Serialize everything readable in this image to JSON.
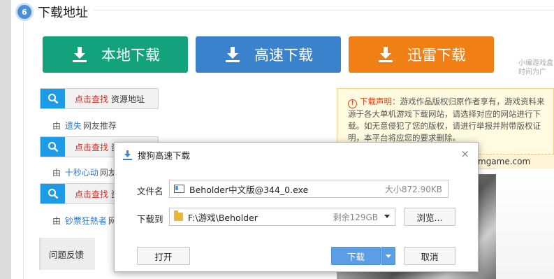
{
  "section": {
    "number": "6",
    "title": "下载地址"
  },
  "buttons": {
    "local": "本地下载",
    "fast": "高速下载",
    "thunder": "迅雷下载"
  },
  "ad": {
    "line1": "小编游戏盒",
    "line2": "时间为广"
  },
  "notice": {
    "label": "下载声明：",
    "text": "游戏作品版权归原作者享有，游戏资料来源于各大单机游戏下载网站，请选择对应的网站进行下载。如无意侵犯了您的版权，请进行举报并附带版权证明，本平台将应您的要求删除。",
    "url": "mgame.com"
  },
  "sources": [
    {
      "action": "点击查找",
      "label": "资源地址",
      "prefix": "由",
      "user": "遗失",
      "suffix": "网友推荐"
    },
    {
      "action": "点击查找",
      "label": "资",
      "prefix": "由",
      "user": "十秒心动",
      "suffix": "网友"
    },
    {
      "action": "点击查找",
      "label": "资",
      "prefix": "由",
      "user": "钞票狂熱者",
      "suffix": "网"
    }
  ],
  "feedback": "问题反馈",
  "dialog": {
    "title": "搜狗高速下载",
    "close": "×",
    "file_label": "文件名",
    "file_name": "Beholder中文版@344_0.exe",
    "file_size": "大小872.90KB",
    "dest_label": "下载到",
    "dest_path": "F:\\游戏\\Beholder",
    "free_space": "剩余129GB",
    "browse": "浏览...",
    "open": "打开",
    "download": "下载",
    "cancel": "取消"
  },
  "colors": {
    "local": "#12a37c",
    "fast": "#3a83cc",
    "thunder": "#f07f16",
    "accent_blue": "#1e9be6",
    "red": "#d9271a"
  }
}
